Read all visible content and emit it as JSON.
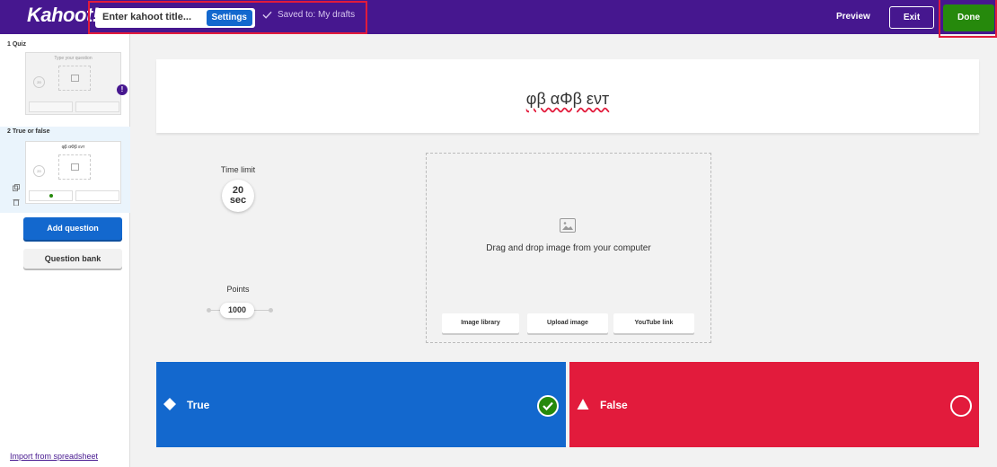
{
  "header": {
    "logo": "Kahoot!",
    "title_placeholder": "Enter kahoot title...",
    "settings_label": "Settings",
    "saved_text": "Saved to: My drafts",
    "preview_label": "Preview",
    "exit_label": "Exit",
    "done_label": "Done"
  },
  "sidebar": {
    "slides": [
      {
        "label": "1 Quiz",
        "thumb_question": "Type your question",
        "time": "20"
      },
      {
        "label": "2 True or false",
        "thumb_question": "φβ αΦβ ενт",
        "time": "20"
      }
    ],
    "add_question_label": "Add question",
    "question_bank_label": "Question bank",
    "import_label": "Import from spreadsheet"
  },
  "editor": {
    "question_text": "φβ αΦβ ενт",
    "time_limit_label": "Time limit",
    "time_value": "20",
    "time_unit": "sec",
    "points_label": "Points",
    "points_value": "1000",
    "media_prompt": "Drag and drop image from your computer",
    "media_buttons": [
      "Image library",
      "Upload image",
      "YouTube link"
    ]
  },
  "answers": [
    {
      "label": "True",
      "correct": true,
      "color": "#1368ce"
    },
    {
      "label": "False",
      "correct": false,
      "color": "#e21b3c"
    }
  ],
  "colors": {
    "brand_purple": "#46178f",
    "blue": "#1368ce",
    "red": "#e21b3c",
    "green": "#26890c"
  }
}
